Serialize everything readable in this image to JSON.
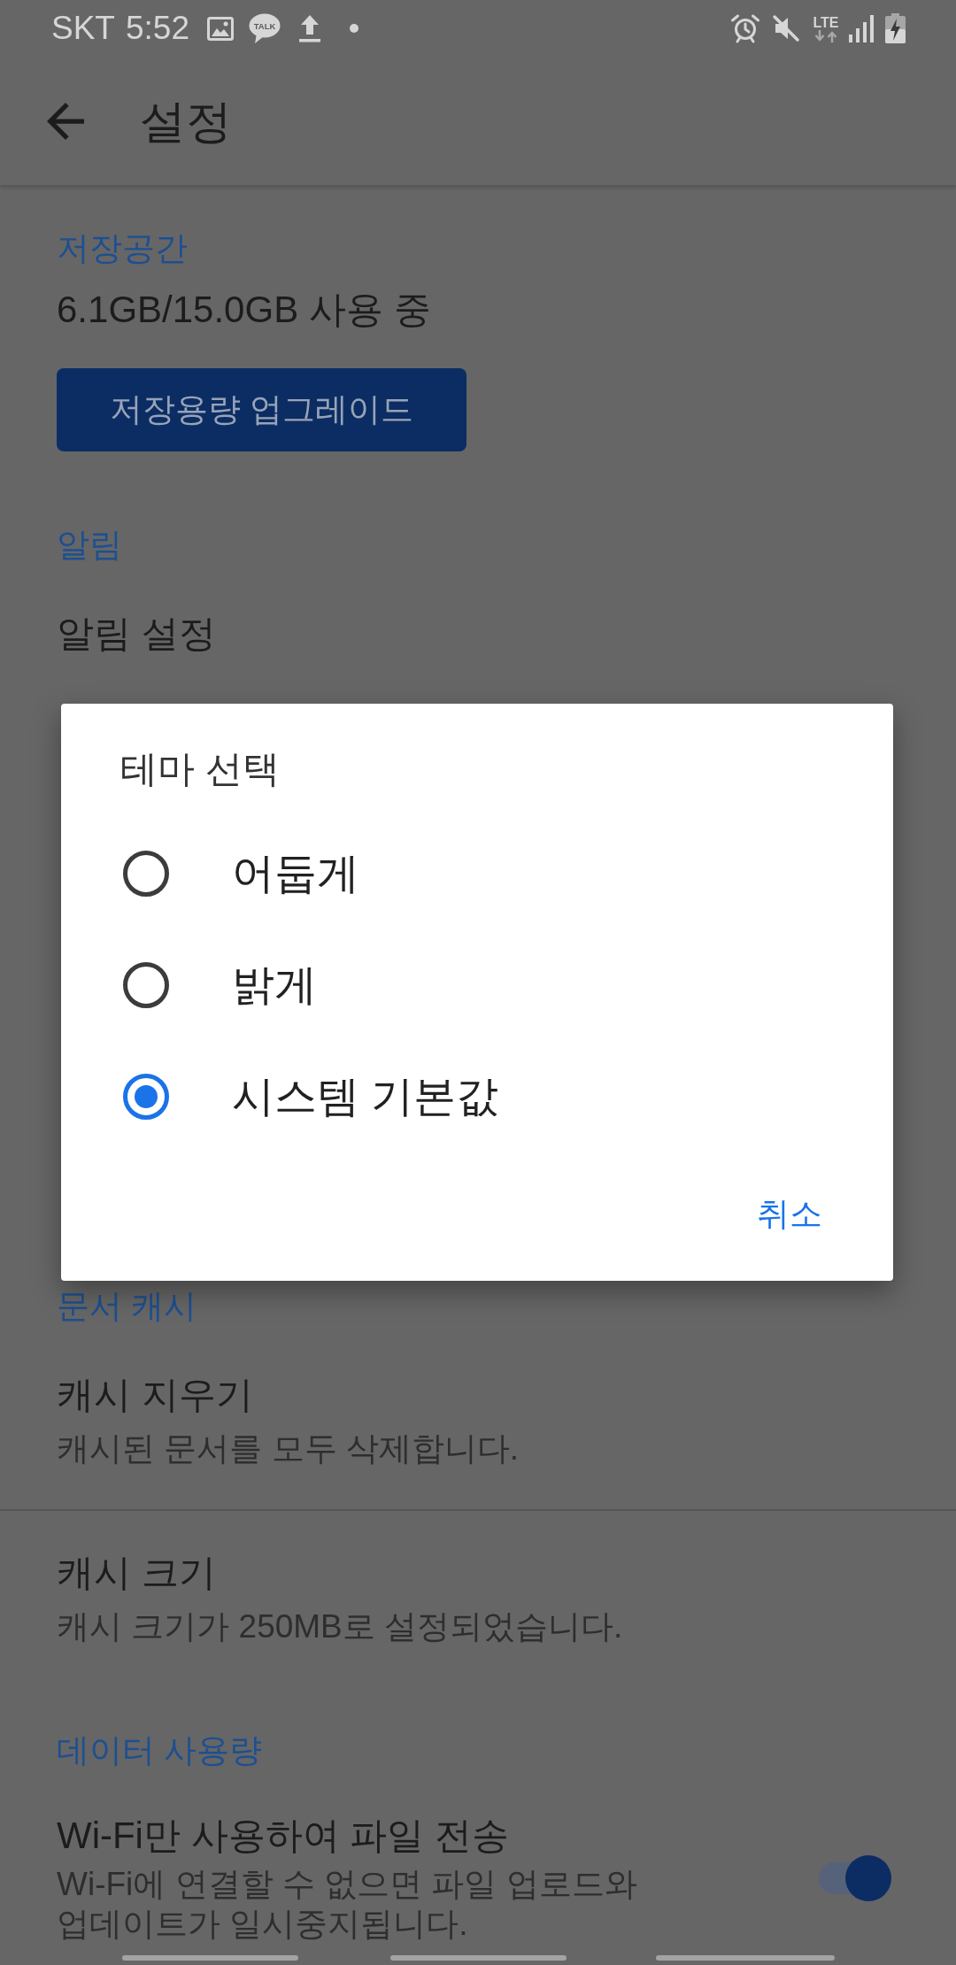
{
  "status_bar": {
    "carrier": "SKT",
    "time": "5:52",
    "chat_badge": "TALK",
    "network_type": "LTE"
  },
  "app_bar": {
    "title": "설정"
  },
  "settings_above_dialog": [
    {
      "header": "저장공간",
      "items": [
        {
          "kind": "usage",
          "title": "6.1GB/15.0GB 사용 중"
        },
        {
          "kind": "button",
          "label": "저장용량 업그레이드"
        }
      ]
    },
    {
      "header": "알림",
      "items": [
        {
          "kind": "item",
          "title": "알림 설정"
        }
      ]
    }
  ],
  "theme_dialog": {
    "title": "테마 선택",
    "options": [
      {
        "label": "어둡게",
        "selected": false
      },
      {
        "label": "밝게",
        "selected": false
      },
      {
        "label": "시스템 기본값",
        "selected": true
      }
    ],
    "cancel_button": "취소"
  },
  "settings_below_dialog": [
    {
      "header": "문서 캐시",
      "items": [
        {
          "kind": "item",
          "title": "캐시 지우기",
          "subtitle": "캐시된 문서를 모두 삭제합니다."
        },
        {
          "kind": "item",
          "title": "캐시 크기",
          "subtitle": "캐시 크기가 250MB로 설정되었습니다."
        }
      ]
    },
    {
      "header": "데이터 사용량",
      "items": [
        {
          "kind": "switch",
          "title": "Wi-Fi만 사용하여 파일 전송",
          "subtitle": "Wi-Fi에 연결할 수 없으면 파일 업로드와 업데이트가 일시중지됩니다.",
          "on": true
        }
      ]
    }
  ]
}
